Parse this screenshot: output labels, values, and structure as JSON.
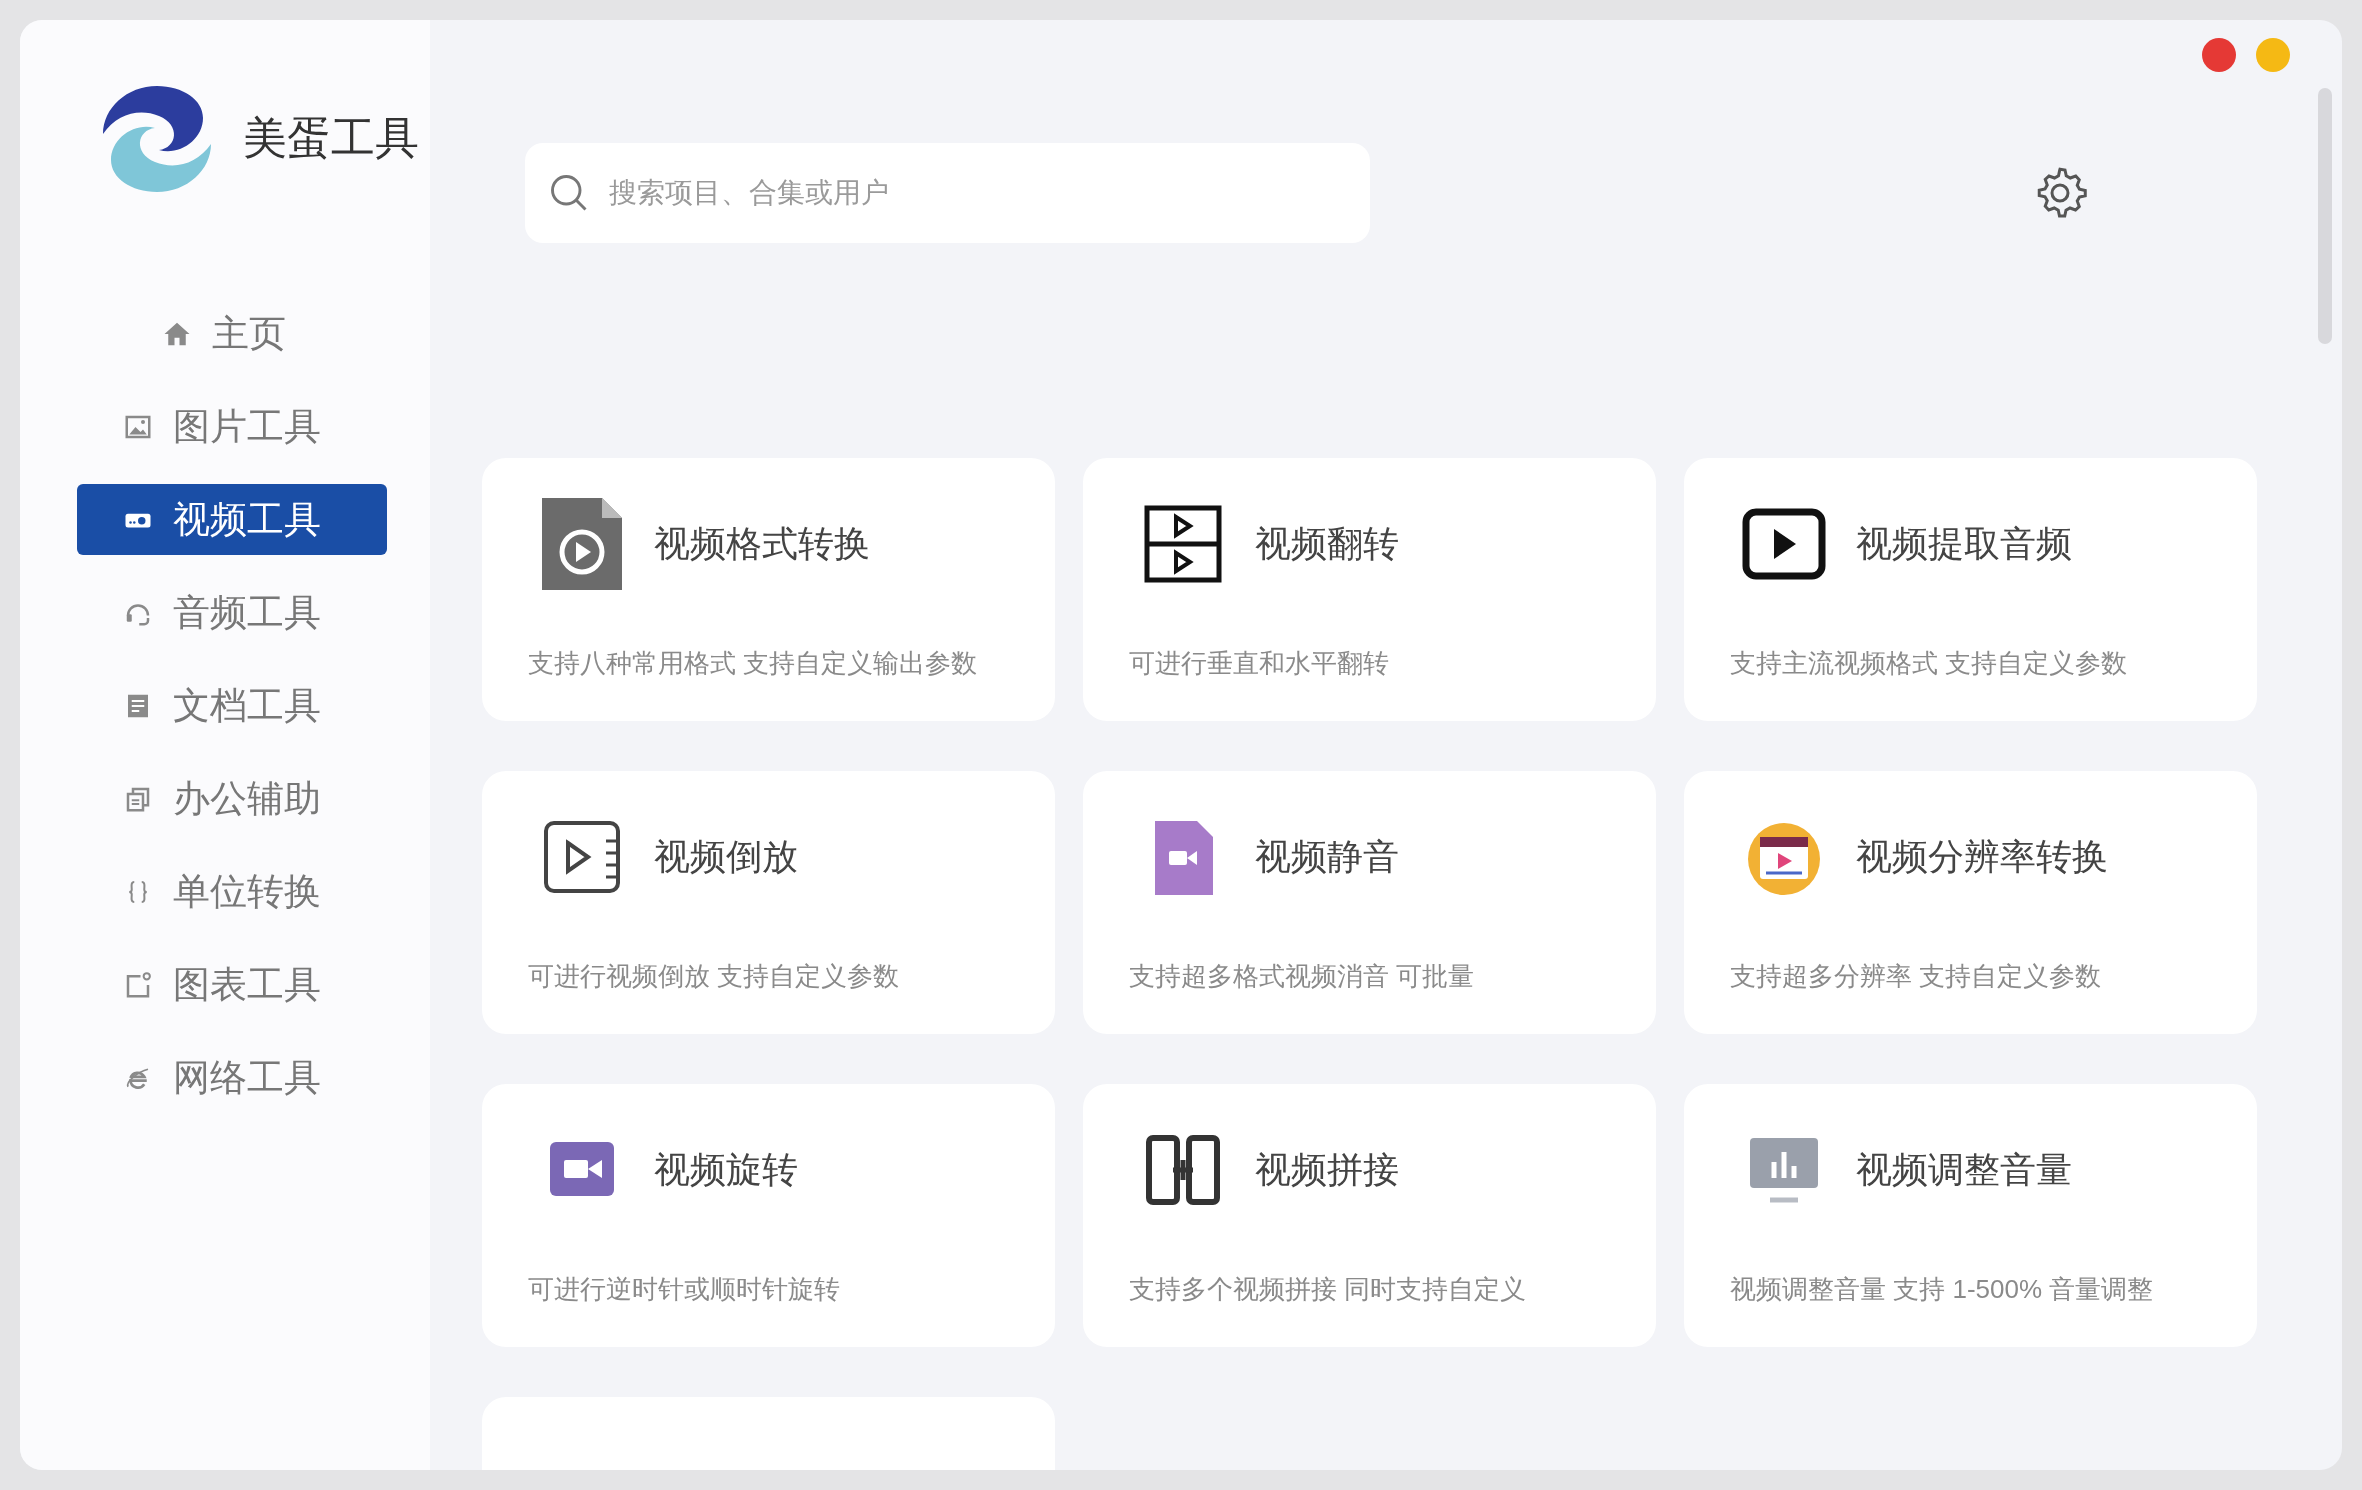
{
  "app": {
    "name": "美蛋工具"
  },
  "sidebar": {
    "items": [
      {
        "label": "主页",
        "selected": false
      },
      {
        "label": "图片工具",
        "selected": false
      },
      {
        "label": "视频工具",
        "selected": true
      },
      {
        "label": "音频工具",
        "selected": false
      },
      {
        "label": "文档工具",
        "selected": false
      },
      {
        "label": "办公辅助",
        "selected": false
      },
      {
        "label": "单位转换",
        "selected": false
      },
      {
        "label": "图表工具",
        "selected": false
      },
      {
        "label": "网络工具",
        "selected": false
      }
    ]
  },
  "search": {
    "placeholder": "搜索项目、合集或用户"
  },
  "window_controls": [
    {
      "color": "#e53935"
    },
    {
      "color": "#f5b914"
    }
  ],
  "tools": [
    {
      "kind": "tool",
      "title": "视频格式转换",
      "description": "支持八种常用格式 支持自定义输出参数"
    },
    {
      "kind": "tool",
      "title": "视频翻转",
      "description": "可进行垂直和水平翻转"
    },
    {
      "kind": "tool",
      "title": "视频提取音频",
      "description": "支持主流视频格式 支持自定义参数"
    },
    {
      "kind": "tool",
      "title": "视频倒放",
      "description": "可进行视频倒放 支持自定义参数"
    },
    {
      "kind": "tool",
      "title": "视频静音",
      "description": "支持超多格式视频消音 可批量"
    },
    {
      "kind": "tool",
      "title": "视频分辨率转换",
      "description": "支持超多分辨率 支持自定义参数"
    },
    {
      "kind": "tool",
      "title": "视频旋转",
      "description": "可进行逆时针或顺时针旋转"
    },
    {
      "kind": "tool",
      "title": "视频拼接",
      "description": "支持多个视频拼接 同时支持自定义"
    },
    {
      "kind": "tool",
      "title": "视频调整音量",
      "description": "视频调整音量 支持 1-500% 音量调整"
    },
    {
      "kind": "empty"
    }
  ]
}
